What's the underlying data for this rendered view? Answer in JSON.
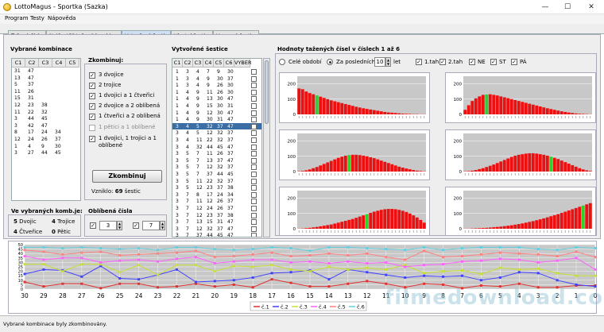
{
  "window": {
    "title": "LottoMagus - Sportka (Sazka)",
    "min": "—",
    "max": "☐",
    "close": "✕"
  },
  "menu": [
    "Program",
    "Testy",
    "Nápověda"
  ],
  "tabs": [
    "Tažená čísla",
    "Nejčastěji tažené kombinace",
    "Vytvořené šestice",
    "Vlastní šestice",
    "Vsazené šestice"
  ],
  "vybrane": {
    "title": "Vybrané kombinace",
    "cols": [
      "C1",
      "C2",
      "C3",
      "C4",
      "C5"
    ],
    "rows": [
      [
        "31",
        "47",
        "",
        "",
        ""
      ],
      [
        "13",
        "47",
        "",
        "",
        ""
      ],
      [
        "5",
        "37",
        "",
        "",
        ""
      ],
      [
        "11",
        "26",
        "",
        "",
        ""
      ],
      [
        "15",
        "31",
        "",
        "",
        ""
      ],
      [
        "12",
        "23",
        "38",
        "",
        ""
      ],
      [
        "11",
        "22",
        "32",
        "",
        ""
      ],
      [
        "3",
        "44",
        "45",
        "",
        ""
      ],
      [
        "3",
        "42",
        "47",
        "",
        ""
      ],
      [
        "8",
        "17",
        "24",
        "34",
        ""
      ],
      [
        "12",
        "24",
        "26",
        "37",
        ""
      ],
      [
        "1",
        "4",
        "9",
        "30",
        ""
      ],
      [
        "3",
        "27",
        "44",
        "45",
        ""
      ]
    ]
  },
  "zkombinuj": {
    "title": "Zkombinuj:",
    "options": [
      "3 dvojice",
      "2 trojice",
      "1 dvojici a 1 čtveřici",
      "2 dvojice a 2 oblíbená",
      "1 čtveřici a 2 oblíbená",
      "1 pětici a 1 oblíbené",
      "1 dvojici, 1 trojici a 1 oblíbené"
    ],
    "checked": [
      true,
      true,
      true,
      true,
      true,
      false,
      true
    ],
    "button": "Zkombinuj",
    "vzniklo_label": "Vzniklo:",
    "vzniklo_value": "69",
    "vzniklo_unit": "šestic"
  },
  "ve_vybranych": {
    "title": "Ve vybraných komb.je:",
    "dvojic_n": "5",
    "dvojic": "Dvojic",
    "trojice_n": "4",
    "trojice": "Trojice",
    "ctverice_n": "4",
    "ctverice": "Čtveřice",
    "petic_n": "0",
    "petic": "Pětic"
  },
  "oblibena": {
    "title": "Oblíbená čísla",
    "v1": "3",
    "v2": "7"
  },
  "vytvorene": {
    "title": "Vytvořené šestice",
    "cols": [
      "C1",
      "C2",
      "C3",
      "C4",
      "C5",
      "C6",
      "VYBER"
    ],
    "rows": [
      [
        "1",
        "3",
        "4",
        "7",
        "9",
        "30"
      ],
      [
        "1",
        "3",
        "4",
        "9",
        "30",
        "37"
      ],
      [
        "1",
        "3",
        "4",
        "9",
        "26",
        "30"
      ],
      [
        "1",
        "4",
        "9",
        "11",
        "26",
        "30"
      ],
      [
        "1",
        "4",
        "9",
        "13",
        "30",
        "47"
      ],
      [
        "1",
        "4",
        "9",
        "15",
        "30",
        "31"
      ],
      [
        "1",
        "4",
        "9",
        "12",
        "30",
        "47"
      ],
      [
        "1",
        "4",
        "9",
        "30",
        "31",
        "47"
      ],
      [
        "3",
        "4",
        "5",
        "32",
        "37",
        "47"
      ],
      [
        "3",
        "4",
        "5",
        "12",
        "32",
        "37"
      ],
      [
        "3",
        "4",
        "11",
        "22",
        "32",
        "37"
      ],
      [
        "3",
        "4",
        "32",
        "44",
        "45",
        "47"
      ],
      [
        "3",
        "5",
        "7",
        "11",
        "26",
        "37"
      ],
      [
        "3",
        "5",
        "7",
        "13",
        "37",
        "47"
      ],
      [
        "3",
        "5",
        "7",
        "12",
        "32",
        "37"
      ],
      [
        "3",
        "5",
        "7",
        "37",
        "44",
        "45"
      ],
      [
        "3",
        "5",
        "11",
        "22",
        "32",
        "37"
      ],
      [
        "3",
        "5",
        "12",
        "23",
        "37",
        "38"
      ],
      [
        "3",
        "7",
        "8",
        "17",
        "24",
        "34"
      ],
      [
        "3",
        "7",
        "11",
        "12",
        "26",
        "37"
      ],
      [
        "3",
        "7",
        "12",
        "24",
        "26",
        "37"
      ],
      [
        "3",
        "7",
        "12",
        "23",
        "37",
        "38"
      ],
      [
        "3",
        "7",
        "13",
        "15",
        "31",
        "47"
      ],
      [
        "3",
        "7",
        "12",
        "32",
        "37",
        "47"
      ],
      [
        "3",
        "7",
        "37",
        "44",
        "45",
        "47"
      ]
    ],
    "selected_index": 8
  },
  "hodnoty": {
    "title": "Hodnoty tažených čísel v číslech 1 až 6",
    "cele": "Celé období",
    "za_posl": "Za posledních",
    "roky": "10",
    "let": "let",
    "c1": "1.tah",
    "c2": "2.tah",
    "ne": "NE",
    "st": "ST",
    "pa": "PÁ"
  },
  "bottom": {
    "labels": [
      "30",
      "29",
      "28",
      "27",
      "26",
      "25",
      "24",
      "23",
      "22",
      "21",
      "20",
      "19",
      "18",
      "17",
      "16",
      "15",
      "14",
      "13",
      "12",
      "11",
      "10",
      "9",
      "8",
      "7",
      "6",
      "5",
      "4",
      "3",
      "2",
      "1",
      "0"
    ],
    "yticks": [
      "50",
      "45",
      "40",
      "35",
      "30",
      "25",
      "20",
      "15",
      "10",
      "5",
      "0"
    ],
    "legend": [
      "č.1",
      "č.2",
      "č.3",
      "č.4",
      "č.5",
      "č.6"
    ],
    "colors": [
      "#e03030",
      "#4040ff",
      "#c8e030",
      "#ff60ff",
      "#ff8080",
      "#60d0e0"
    ],
    "series": [
      [
        8,
        3,
        6,
        6,
        1,
        6,
        6,
        2,
        3,
        6,
        3,
        5,
        2,
        11,
        7,
        3,
        3,
        6,
        9,
        6,
        2,
        6,
        5,
        1,
        4,
        3,
        6,
        2,
        2,
        4,
        4
      ],
      [
        17,
        22,
        21,
        14,
        26,
        12,
        11,
        16,
        22,
        8,
        9,
        10,
        13,
        18,
        19,
        21,
        11,
        22,
        19,
        16,
        13,
        15,
        14,
        15,
        10,
        13,
        19,
        18,
        10,
        5,
        3
      ],
      [
        28,
        28,
        20,
        28,
        28,
        19,
        27,
        16,
        27,
        27,
        20,
        26,
        25,
        27,
        22,
        20,
        25,
        22,
        24,
        22,
        27,
        18,
        20,
        21,
        17,
        24,
        22,
        23,
        18,
        15,
        15
      ],
      [
        37,
        33,
        35,
        35,
        30,
        32,
        33,
        31,
        34,
        36,
        29,
        31,
        33,
        33,
        30,
        31,
        29,
        31,
        29,
        30,
        25,
        27,
        28,
        31,
        32,
        34,
        33,
        30,
        32,
        35,
        22
      ],
      [
        44,
        42,
        39,
        41,
        42,
        38,
        39,
        40,
        41,
        43,
        36,
        37,
        39,
        41,
        37,
        38,
        40,
        38,
        40,
        36,
        33,
        43,
        36,
        37,
        39,
        41,
        40,
        39,
        37,
        42,
        36
      ],
      [
        47,
        47,
        46,
        47,
        46,
        45,
        46,
        44,
        47,
        47,
        45,
        44,
        45,
        47,
        46,
        43,
        47,
        47,
        46,
        45,
        44,
        47,
        44,
        46,
        47,
        47,
        47,
        45,
        44,
        47,
        46
      ]
    ]
  },
  "status": "Vybrané kombinace byly zkombinovány.",
  "watermark": "filmedownload.com",
  "hist_charts": [
    {
      "yticks": [
        "200",
        "100",
        "0"
      ],
      "green": 5,
      "vals": [
        170,
        165,
        150,
        140,
        132,
        124,
        116,
        108,
        100,
        92,
        86,
        80,
        74,
        68,
        62,
        56,
        50,
        45,
        40,
        36,
        32,
        28,
        24,
        20,
        16,
        13,
        11,
        9,
        7,
        5,
        4,
        3,
        2,
        2,
        1,
        1
      ]
    },
    {
      "yticks": [
        "200",
        "100",
        "0"
      ],
      "green": 6,
      "vals": [
        30,
        60,
        88,
        105,
        118,
        128,
        130,
        132,
        128,
        124,
        118,
        112,
        106,
        100,
        94,
        88,
        82,
        76,
        70,
        64,
        58,
        52,
        46,
        40,
        35,
        30,
        25,
        20,
        16,
        12,
        9,
        6,
        4,
        3,
        2,
        1
      ]
    },
    {
      "yticks": [
        "200",
        "100",
        "0"
      ],
      "green": 14,
      "vals": [
        2,
        4,
        8,
        14,
        22,
        30,
        40,
        50,
        60,
        70,
        80,
        90,
        98,
        104,
        108,
        110,
        110,
        108,
        104,
        100,
        94,
        88,
        80,
        72,
        64,
        56,
        48,
        40,
        32,
        26,
        20,
        15,
        10,
        6,
        4,
        2
      ]
    },
    {
      "yticks": [
        "200",
        "100",
        "0"
      ],
      "green": 24,
      "vals": [
        2,
        3,
        6,
        10,
        16,
        22,
        30,
        38,
        46,
        56,
        66,
        76,
        86,
        96,
        104,
        110,
        114,
        118,
        120,
        120,
        118,
        114,
        110,
        104,
        98,
        90,
        82,
        72,
        62,
        52,
        42,
        32,
        22,
        14,
        8,
        4
      ]
    },
    {
      "yticks": [
        "200",
        "100",
        "0"
      ],
      "green": 19,
      "vals": [
        1,
        2,
        4,
        6,
        9,
        12,
        16,
        20,
        24,
        28,
        34,
        40,
        46,
        52,
        58,
        64,
        72,
        80,
        88,
        96,
        104,
        112,
        118,
        124,
        128,
        130,
        130,
        128,
        124,
        118,
        110,
        100,
        88,
        74,
        58,
        40
      ]
    },
    {
      "yticks": [
        "200",
        "100",
        "0"
      ],
      "green": 33,
      "vals": [
        1,
        1,
        2,
        3,
        4,
        5,
        6,
        8,
        10,
        12,
        14,
        17,
        20,
        23,
        27,
        31,
        35,
        40,
        45,
        50,
        56,
        62,
        68,
        75,
        82,
        89,
        96,
        104,
        112,
        120,
        128,
        136,
        144,
        152,
        160,
        168
      ]
    }
  ]
}
